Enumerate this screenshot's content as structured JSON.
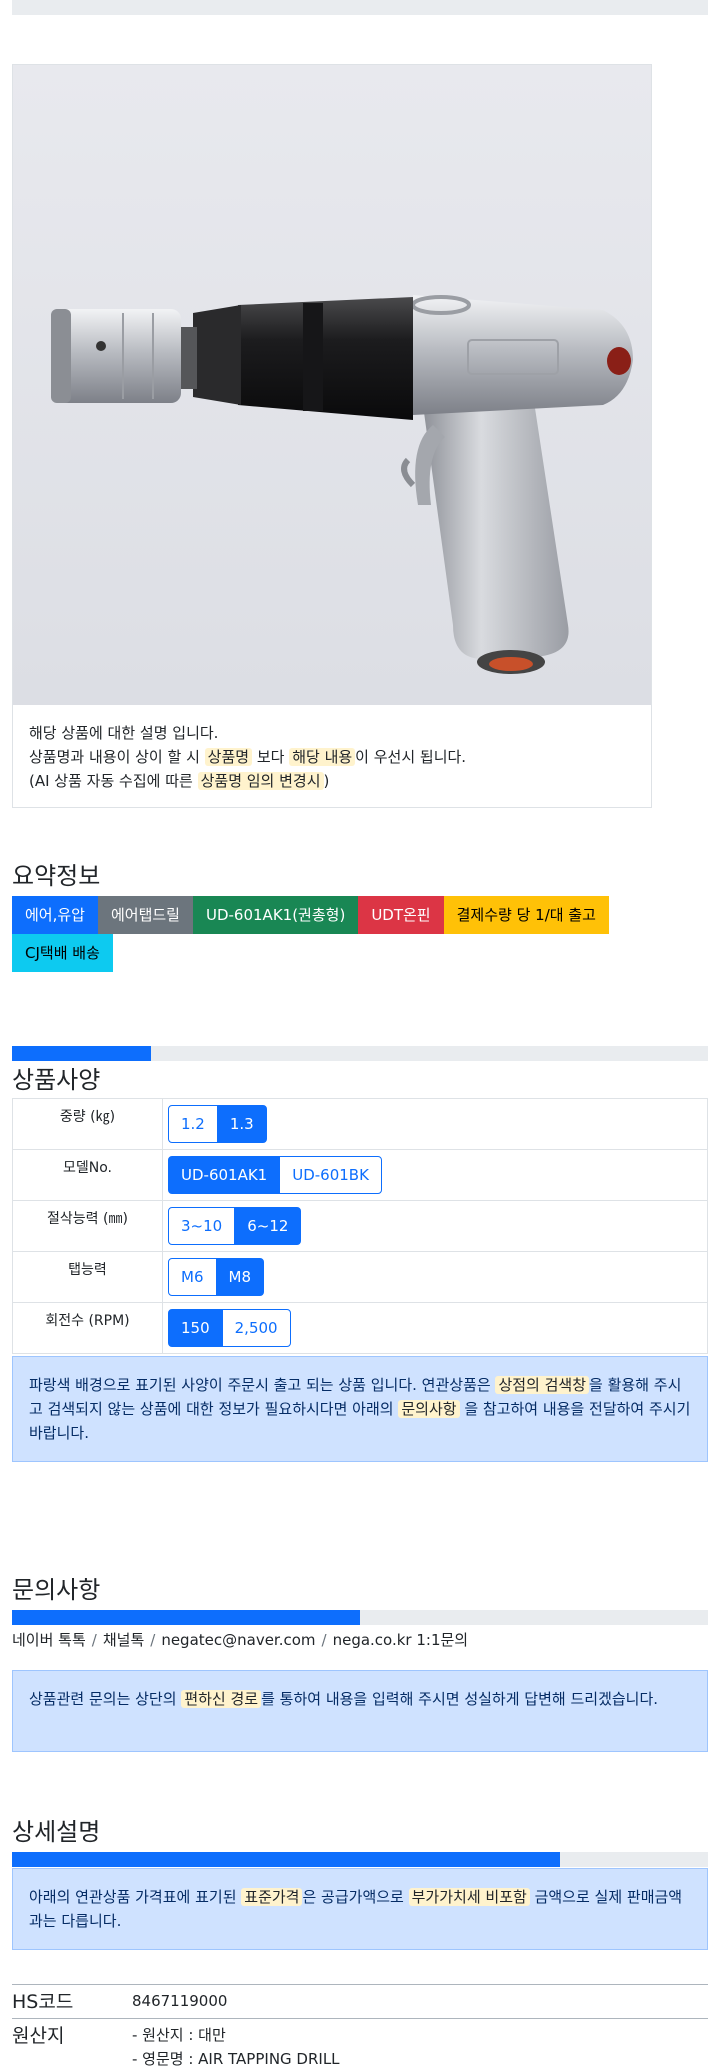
{
  "product": {
    "notice_line1": "해당 상품에 대한 설명 입니다.",
    "notice_line2_a": "상품명과 내용이 상이 할 시 ",
    "notice_line2_hl1": "상품명",
    "notice_line2_b": " 보다 ",
    "notice_line2_hl2": "해당 내용",
    "notice_line2_c": "이 우선시 됩니다.",
    "notice_line3_a": "(AI 상품 자동 수집에 따른 ",
    "notice_line3_hl": "상품명 임의 변경시",
    "notice_line3_b": ")"
  },
  "summary": {
    "title": "요약정보",
    "badges": [
      {
        "label": "에어,유압",
        "color": "#0d6efd",
        "text": "#ffffff"
      },
      {
        "label": "에어탭드릴",
        "color": "#6c757d",
        "text": "#ffffff"
      },
      {
        "label": "UD-601AK1(권총형)",
        "color": "#198754",
        "text": "#ffffff"
      },
      {
        "label": "UDT온핀",
        "color": "#dc3545",
        "text": "#ffffff"
      },
      {
        "label": "결제수량 당 1/대 출고",
        "color": "#ffc107",
        "text": "#000000"
      },
      {
        "label": "CJ택배 배송",
        "color": "#0dcaf0",
        "text": "#000000"
      }
    ]
  },
  "spec": {
    "title": "상품사양",
    "progress": 0.25,
    "rows": [
      {
        "label": "중량 (㎏)",
        "options": [
          {
            "text": "1.2",
            "on": false
          },
          {
            "text": "1.3",
            "on": true
          }
        ]
      },
      {
        "label": "모델No.",
        "options": [
          {
            "text": "UD-601AK1",
            "on": true
          },
          {
            "text": "UD-601BK",
            "on": false
          }
        ]
      },
      {
        "label": "절삭능력 (㎜)",
        "options": [
          {
            "text": "3~10",
            "on": false
          },
          {
            "text": "6~12",
            "on": true
          }
        ]
      },
      {
        "label": "탭능력",
        "options": [
          {
            "text": "M6",
            "on": false
          },
          {
            "text": "M8",
            "on": true
          }
        ]
      },
      {
        "label": "회전수 (RPM)",
        "options": [
          {
            "text": "150",
            "on": true
          },
          {
            "text": "2,500",
            "on": false
          }
        ]
      }
    ],
    "note_a": "파랑색 배경으로 표기된 사양이 주문시 출고 되는 상품 입니다. 연관상품은 ",
    "note_hl1": "상점의 검색창",
    "note_b": "을 활용해 주시고 검색되지 않는 상품에 대한 정보가 필요하시다면 아래의 ",
    "note_hl2": "문의사항",
    "note_c": " 을 참고하여 내용을 전달하여 주시기 바랍니다."
  },
  "inquiry": {
    "title": "문의사항",
    "progress": 0.5,
    "links": [
      "네이버 톡톡",
      "채널톡",
      "negatec@naver.com",
      "nega.co.kr 1:1문의"
    ],
    "separator": "/",
    "note_a": "상품관련 문의는 상단의 ",
    "note_hl": "편하신 경로",
    "note_b": "를 통하여 내용을 입력해 주시면 성실하게 답변해 드리겠습니다."
  },
  "detail": {
    "title": "상세설명",
    "progress": 0.75,
    "note_a": "아래의 연관상품 가격표에 표기된 ",
    "note_hl1": "표준가격",
    "note_b": "은 공급가액으로 ",
    "note_hl2": "부가가치세 비포함",
    "note_c": " 금액으로 실제 판매금액과는 다릅니다.",
    "hs_label": "HS코드",
    "hs_value": "8467119000",
    "origin_label": "원산지",
    "origin_line1": "- 원산지 : 대만",
    "origin_line2": "- 영문명 : AIR TAPPING DRILL"
  }
}
